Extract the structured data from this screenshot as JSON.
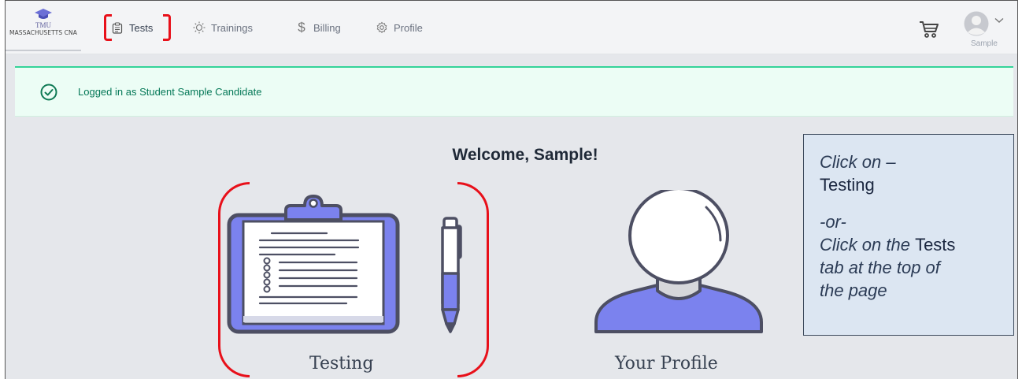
{
  "logo": {
    "line1": "TMU",
    "line2": "MASSACHUSETTS CNA"
  },
  "nav": {
    "items": [
      {
        "label": "Tests",
        "icon": "clipboard-icon",
        "active": true
      },
      {
        "label": "Trainings",
        "icon": "lightbulb-icon",
        "active": false
      },
      {
        "label": "Billing",
        "icon": "dollar-icon",
        "active": false
      },
      {
        "label": "Profile",
        "icon": "gear-icon",
        "active": false
      }
    ]
  },
  "user": {
    "name": "Sample"
  },
  "alert": {
    "message": "Logged in as Student Sample Candidate"
  },
  "main": {
    "welcome": "Welcome, Sample!",
    "cards": [
      {
        "label": "Testing",
        "icon": "clipboard-pen-illustration"
      },
      {
        "label": "Your Profile",
        "icon": "person-avatar-illustration"
      }
    ]
  },
  "callout": {
    "line1": "Click on –",
    "line2": "Testing",
    "line3": "-or-",
    "line4a": "Click on the ",
    "line4b": "Tests",
    "line5": "tab at the top of",
    "line6": "the page"
  },
  "colors": {
    "accent": "#7b82ee",
    "alert_bg": "#ecfdf5",
    "alert_text": "#047857",
    "highlight_red": "#e8101a",
    "callout_bg": "#dce6f2"
  }
}
